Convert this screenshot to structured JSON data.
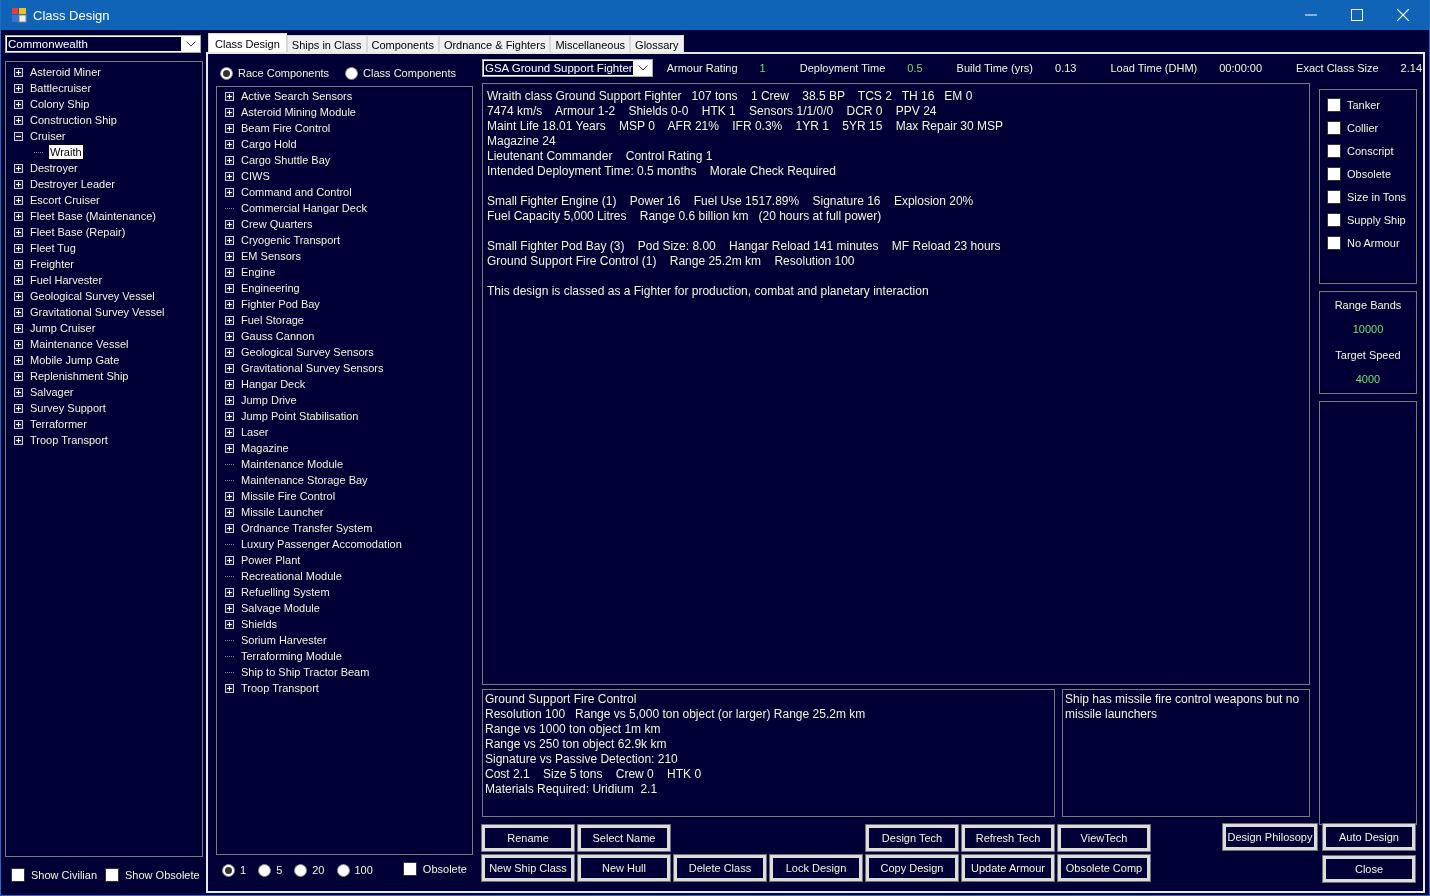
{
  "window": {
    "title": "Class Design"
  },
  "race_select": {
    "value": "Commonwealth"
  },
  "class_tree": [
    {
      "label": "Asteroid Miner",
      "kind": "group",
      "expanded": false,
      "selected": false
    },
    {
      "label": "Battlecruiser",
      "kind": "group",
      "expanded": false,
      "selected": false
    },
    {
      "label": "Colony Ship",
      "kind": "group",
      "expanded": false,
      "selected": false
    },
    {
      "label": "Construction Ship",
      "kind": "group",
      "expanded": false,
      "selected": false
    },
    {
      "label": "Cruiser",
      "kind": "group",
      "expanded": true,
      "selected": false,
      "children": [
        {
          "label": "Wraith",
          "kind": "leaf",
          "selected": true
        }
      ]
    },
    {
      "label": "Destroyer",
      "kind": "group",
      "expanded": false,
      "selected": false
    },
    {
      "label": "Destroyer Leader",
      "kind": "group",
      "expanded": false,
      "selected": false
    },
    {
      "label": "Escort Cruiser",
      "kind": "group",
      "expanded": false,
      "selected": false
    },
    {
      "label": "Fleet Base (Maintenance)",
      "kind": "group",
      "expanded": false,
      "selected": false
    },
    {
      "label": "Fleet Base (Repair)",
      "kind": "group",
      "expanded": false,
      "selected": false
    },
    {
      "label": "Fleet Tug",
      "kind": "group",
      "expanded": false,
      "selected": false
    },
    {
      "label": "Freighter",
      "kind": "group",
      "expanded": false,
      "selected": false
    },
    {
      "label": "Fuel Harvester",
      "kind": "group",
      "expanded": false,
      "selected": false
    },
    {
      "label": "Geological Survey Vessel",
      "kind": "group",
      "expanded": false,
      "selected": false
    },
    {
      "label": "Gravitational Survey Vessel",
      "kind": "group",
      "expanded": false,
      "selected": false
    },
    {
      "label": "Jump Cruiser",
      "kind": "group",
      "expanded": false,
      "selected": false
    },
    {
      "label": "Maintenance Vessel",
      "kind": "group",
      "expanded": false,
      "selected": false
    },
    {
      "label": "Mobile Jump Gate",
      "kind": "group",
      "expanded": false,
      "selected": false
    },
    {
      "label": "Replenishment Ship",
      "kind": "group",
      "expanded": false,
      "selected": false
    },
    {
      "label": "Salvager",
      "kind": "group",
      "expanded": false,
      "selected": false
    },
    {
      "label": "Survey Support",
      "kind": "group",
      "expanded": false,
      "selected": false
    },
    {
      "label": "Terraformer",
      "kind": "group",
      "expanded": false,
      "selected": false
    },
    {
      "label": "Troop Transport",
      "kind": "group",
      "expanded": false,
      "selected": false
    }
  ],
  "left_checks": [
    {
      "label": "Show Civilian",
      "checked": false
    },
    {
      "label": "Show Obsolete",
      "checked": false
    }
  ],
  "tabs": [
    {
      "label": "Class Design",
      "selected": true
    },
    {
      "label": "Ships in Class",
      "selected": false
    },
    {
      "label": "Components",
      "selected": false
    },
    {
      "label": "Ordnance & Fighters",
      "selected": false
    },
    {
      "label": "Miscellaneous",
      "selected": false
    },
    {
      "label": "Glossary",
      "selected": false
    }
  ],
  "component_source": [
    {
      "label": "Race Components",
      "selected": true
    },
    {
      "label": "Class Components",
      "selected": false
    }
  ],
  "component_tree": [
    {
      "label": "Active Search Sensors",
      "kind": "group"
    },
    {
      "label": "Asteroid Mining Module",
      "kind": "group"
    },
    {
      "label": "Beam Fire Control",
      "kind": "group"
    },
    {
      "label": "Cargo Hold",
      "kind": "group"
    },
    {
      "label": "Cargo Shuttle Bay",
      "kind": "group"
    },
    {
      "label": "CIWS",
      "kind": "group"
    },
    {
      "label": "Command and Control",
      "kind": "group"
    },
    {
      "label": "Commercial Hangar Deck",
      "kind": "leaf"
    },
    {
      "label": "Crew Quarters",
      "kind": "group"
    },
    {
      "label": "Cryogenic Transport",
      "kind": "group"
    },
    {
      "label": "EM Sensors",
      "kind": "group"
    },
    {
      "label": "Engine",
      "kind": "group"
    },
    {
      "label": "Engineering",
      "kind": "group"
    },
    {
      "label": "Fighter Pod Bay",
      "kind": "group"
    },
    {
      "label": "Fuel Storage",
      "kind": "group"
    },
    {
      "label": "Gauss Cannon",
      "kind": "group"
    },
    {
      "label": "Geological Survey Sensors",
      "kind": "group"
    },
    {
      "label": "Gravitational Survey Sensors",
      "kind": "group"
    },
    {
      "label": "Hangar Deck",
      "kind": "group"
    },
    {
      "label": "Jump Drive",
      "kind": "group"
    },
    {
      "label": "Jump Point Stabilisation",
      "kind": "group"
    },
    {
      "label": "Laser",
      "kind": "group"
    },
    {
      "label": "Magazine",
      "kind": "group"
    },
    {
      "label": "Maintenance Module",
      "kind": "leaf"
    },
    {
      "label": "Maintenance Storage Bay",
      "kind": "leaf"
    },
    {
      "label": "Missile Fire Control",
      "kind": "group"
    },
    {
      "label": "Missile Launcher",
      "kind": "group"
    },
    {
      "label": "Ordnance Transfer System",
      "kind": "group"
    },
    {
      "label": "Luxury Passenger Accomodation",
      "kind": "leaf"
    },
    {
      "label": "Power Plant",
      "kind": "group"
    },
    {
      "label": "Recreational Module",
      "kind": "leaf"
    },
    {
      "label": "Refuelling System",
      "kind": "group"
    },
    {
      "label": "Salvage Module",
      "kind": "group"
    },
    {
      "label": "Shields",
      "kind": "group"
    },
    {
      "label": "Sorium Harvester",
      "kind": "leaf"
    },
    {
      "label": "Terraforming Module",
      "kind": "leaf"
    },
    {
      "label": "Ship to Ship Tractor Beam",
      "kind": "leaf"
    },
    {
      "label": "Troop Transport",
      "kind": "group"
    }
  ],
  "quantity": [
    {
      "label": "1",
      "selected": true
    },
    {
      "label": "5",
      "selected": false
    },
    {
      "label": "20",
      "selected": false
    },
    {
      "label": "100",
      "selected": false
    }
  ],
  "obsolete_check": {
    "label": "Obsolete",
    "checked": false
  },
  "class_select": {
    "value": "GSA Ground Support Fighter"
  },
  "stats": [
    {
      "label": "Armour Rating",
      "value": "1",
      "editable": true
    },
    {
      "label": "Deployment Time",
      "value": "0.5",
      "editable": true
    },
    {
      "label": "Build Time (yrs)",
      "value": "0.13",
      "editable": false
    },
    {
      "label": "Load Time (DHM)",
      "value": "00:00:00",
      "editable": false
    },
    {
      "label": "Exact Class Size",
      "value": "2.14",
      "editable": false
    }
  ],
  "summary": [
    [
      "Wraith class Ground Support Fighter   107 tons    1 Crew    38.5 BP    TCS 2   TH 16   EM 0",
      "7474 km/s    Armour 1-2    Shields 0-0    HTK 1    Sensors 1/1/0/0    DCR 0    PPV 24",
      "Maint Life 18.01 Years    MSP 0    AFR 21%    IFR 0.3%    1YR 1    5YR 15    Max Repair 30 MSP",
      "Magazine 24",
      "Lieutenant Commander    Control Rating 1",
      "Intended Deployment Time: 0.5 months    Morale Check Required"
    ],
    [
      "Small Fighter Engine (1)    Power 16    Fuel Use 1517.89%    Signature 16    Explosion 20%",
      "Fuel Capacity 5,000 Litres    Range 0.6 billion km   (20 hours at full power)"
    ],
    [
      "Small Fighter Pod Bay (3)    Pod Size: 8.00    Hangar Reload 141 minutes    MF Reload 23 hours",
      "Ground Support Fire Control (1)    Range 25.2m km    Resolution 100"
    ],
    [
      "This design is classed as a Fighter for production, combat and planetary interaction"
    ]
  ],
  "component_info": [
    "Ground Support Fire Control",
    "Resolution 100   Range vs 5,000 ton object (or larger) Range 25.2m km",
    "Range vs 1000 ton object 1m km",
    "Range vs 250 ton object 62.9k km",
    "Signature vs Passive Detection: 210",
    "Cost 2.1    Size 5 tons    Crew 0    HTK 0",
    "Materials Required: Uridium  2.1"
  ],
  "design_notes": "Ship has missile fire control weapons but no missile launchers",
  "buttons_top_left": [
    "Rename",
    "Select Name"
  ],
  "buttons_top_right": [
    "Design Tech",
    "Refresh Tech",
    "ViewTech"
  ],
  "buttons_bottom": [
    "New Ship Class",
    "New Hull",
    "Delete Class",
    "Lock Design",
    "Copy Design",
    "Update Armour",
    "Obsolete Comp"
  ],
  "flags": [
    {
      "label": "Tanker",
      "checked": false
    },
    {
      "label": "Collier",
      "checked": false
    },
    {
      "label": "Conscript",
      "checked": false
    },
    {
      "label": "Obsolete",
      "checked": false
    },
    {
      "label": "Size in Tons",
      "checked": false
    },
    {
      "label": "Supply Ship",
      "checked": false
    },
    {
      "label": "No Armour",
      "checked": false
    }
  ],
  "range": [
    {
      "label": "Range Bands",
      "value": "10000"
    },
    {
      "label": "Target Speed",
      "value": "4000"
    }
  ],
  "side_buttons": [
    "Design Philosopy",
    "Auto Design",
    "Close"
  ]
}
